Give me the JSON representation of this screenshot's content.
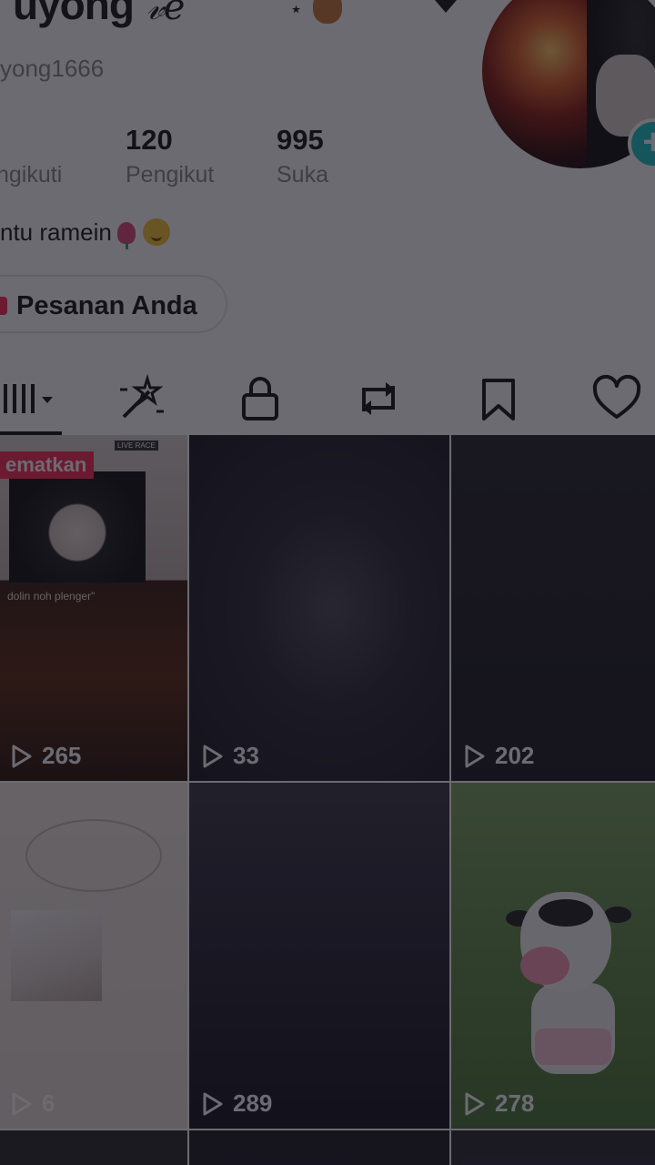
{
  "profile": {
    "display_name": "uyong",
    "name_decoration": "𝓋𝑒",
    "name_star": "⋆",
    "username": "yong1666",
    "avatar_add": "+",
    "stats": [
      {
        "number": "",
        "label": "ngikuti"
      },
      {
        "number": "120",
        "label": "Pengikut"
      },
      {
        "number": "995",
        "label": "Suka"
      }
    ],
    "bio": "ntu ramein",
    "orders_label": "Pesanan Anda"
  },
  "tabs": [
    {
      "icon": "video-grid-icon"
    },
    {
      "icon": "sparkle-wand-icon"
    },
    {
      "icon": "lock-icon"
    },
    {
      "icon": "repost-icon"
    },
    {
      "icon": "bookmark-icon"
    },
    {
      "icon": "heart-icon"
    }
  ],
  "videos": [
    {
      "pin_label": "ematkan",
      "caption": "dolin noh plenger\"",
      "live_badge": "LIVE RACE",
      "count": "265"
    },
    {
      "count": "33"
    },
    {
      "count": "202"
    },
    {
      "count": "6"
    },
    {
      "count": "289"
    },
    {
      "count": "278"
    }
  ],
  "colors": {
    "accent": "#fe2c55",
    "teal": "#20c4c8",
    "overlay": "#12101c"
  }
}
